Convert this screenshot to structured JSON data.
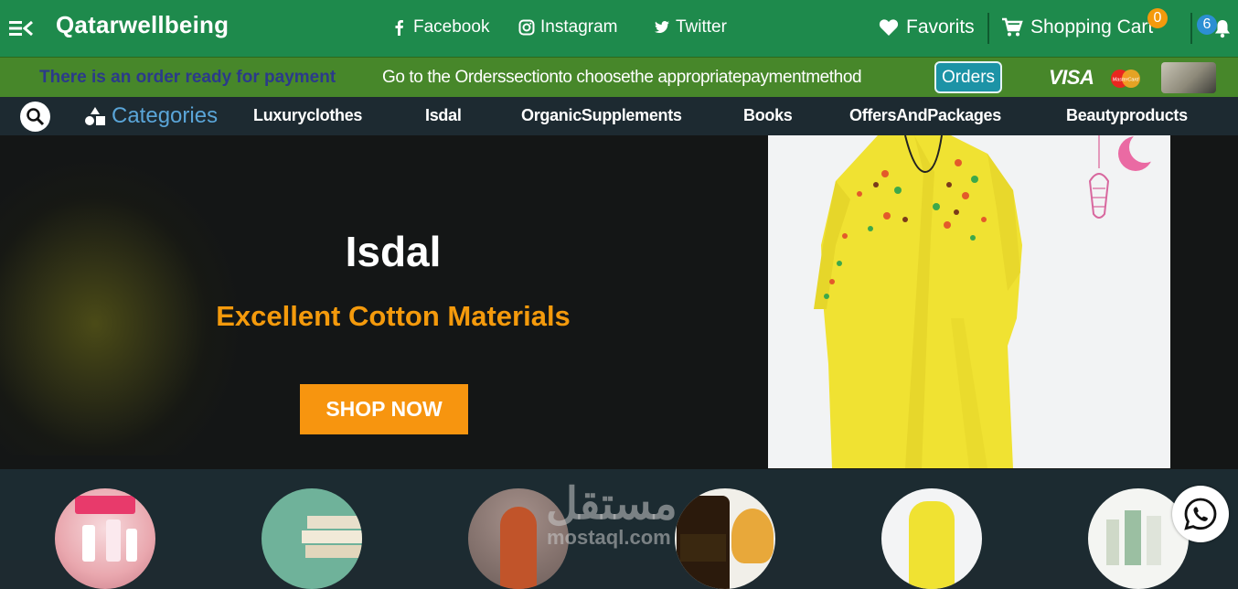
{
  "header": {
    "brand": "Qatarwellbeing",
    "social": [
      {
        "label": "Facebook",
        "icon": "facebook-icon"
      },
      {
        "label": "Instagram",
        "icon": "instagram-icon"
      },
      {
        "label": "Twitter",
        "icon": "twitter-icon"
      }
    ],
    "favorites_label": "Favorits",
    "cart_label": "Shopping Cart",
    "cart_count": "0",
    "notification_count": "6"
  },
  "payment_bar": {
    "alert": "There is an order ready for payment",
    "message": "Go to the Orderssectionto choosethe appropriatepaymentmethod",
    "orders_button": "Orders",
    "visa_label": "VISA",
    "mastercard_label": "MasterCard"
  },
  "category_bar": {
    "title": "Categories",
    "links": [
      "Luxuryclothes",
      "Isdal",
      "OrganicSupplements",
      "Books",
      "OffersAndPackages",
      "Beautyproducts"
    ]
  },
  "hero": {
    "title": "Isdal",
    "subtitle": "Excellent Cotton Materials",
    "button": "SHOP NOW"
  },
  "watermark": {
    "arabic": "مستقل",
    "latin": "mostaql.com"
  },
  "colors": {
    "topbar": "#1e8a4c",
    "paybar": "#47872a",
    "catbar": "#1d2a31",
    "accent_orange": "#f49a0c",
    "link_blue": "#5aa5d8"
  }
}
